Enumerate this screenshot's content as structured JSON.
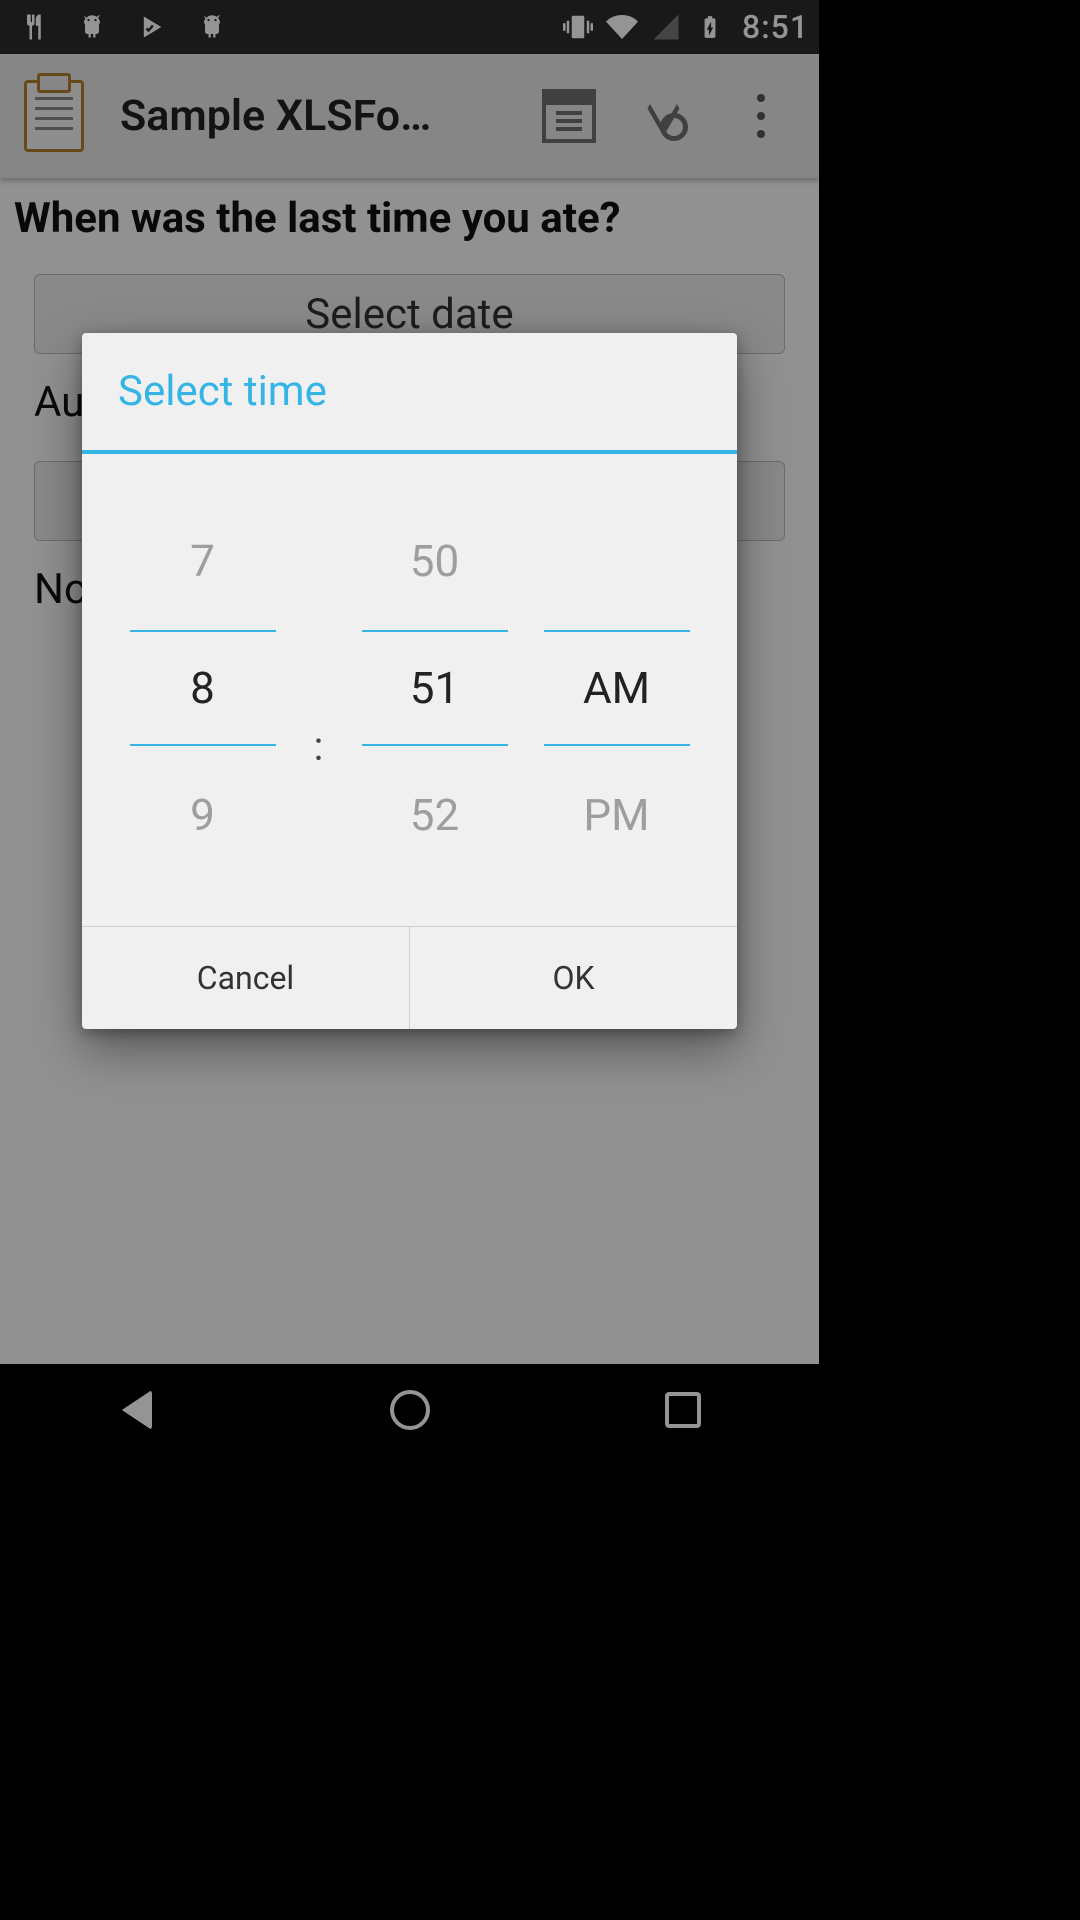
{
  "status": {
    "clock": "8:51"
  },
  "appbar": {
    "title": "Sample XLSFo…"
  },
  "form": {
    "question": "When was the last time you ate?",
    "date_button": "Select date",
    "answer1_prefix": "Au",
    "answer2_prefix": "No"
  },
  "dialog": {
    "title": "Select time",
    "hour_prev": "7",
    "hour_curr": "8",
    "hour_next": "9",
    "minute_prev": "50",
    "minute_curr": "51",
    "minute_next": "52",
    "ampm_curr": "AM",
    "ampm_next": "PM",
    "colon": ":",
    "cancel": "Cancel",
    "ok": "OK"
  }
}
